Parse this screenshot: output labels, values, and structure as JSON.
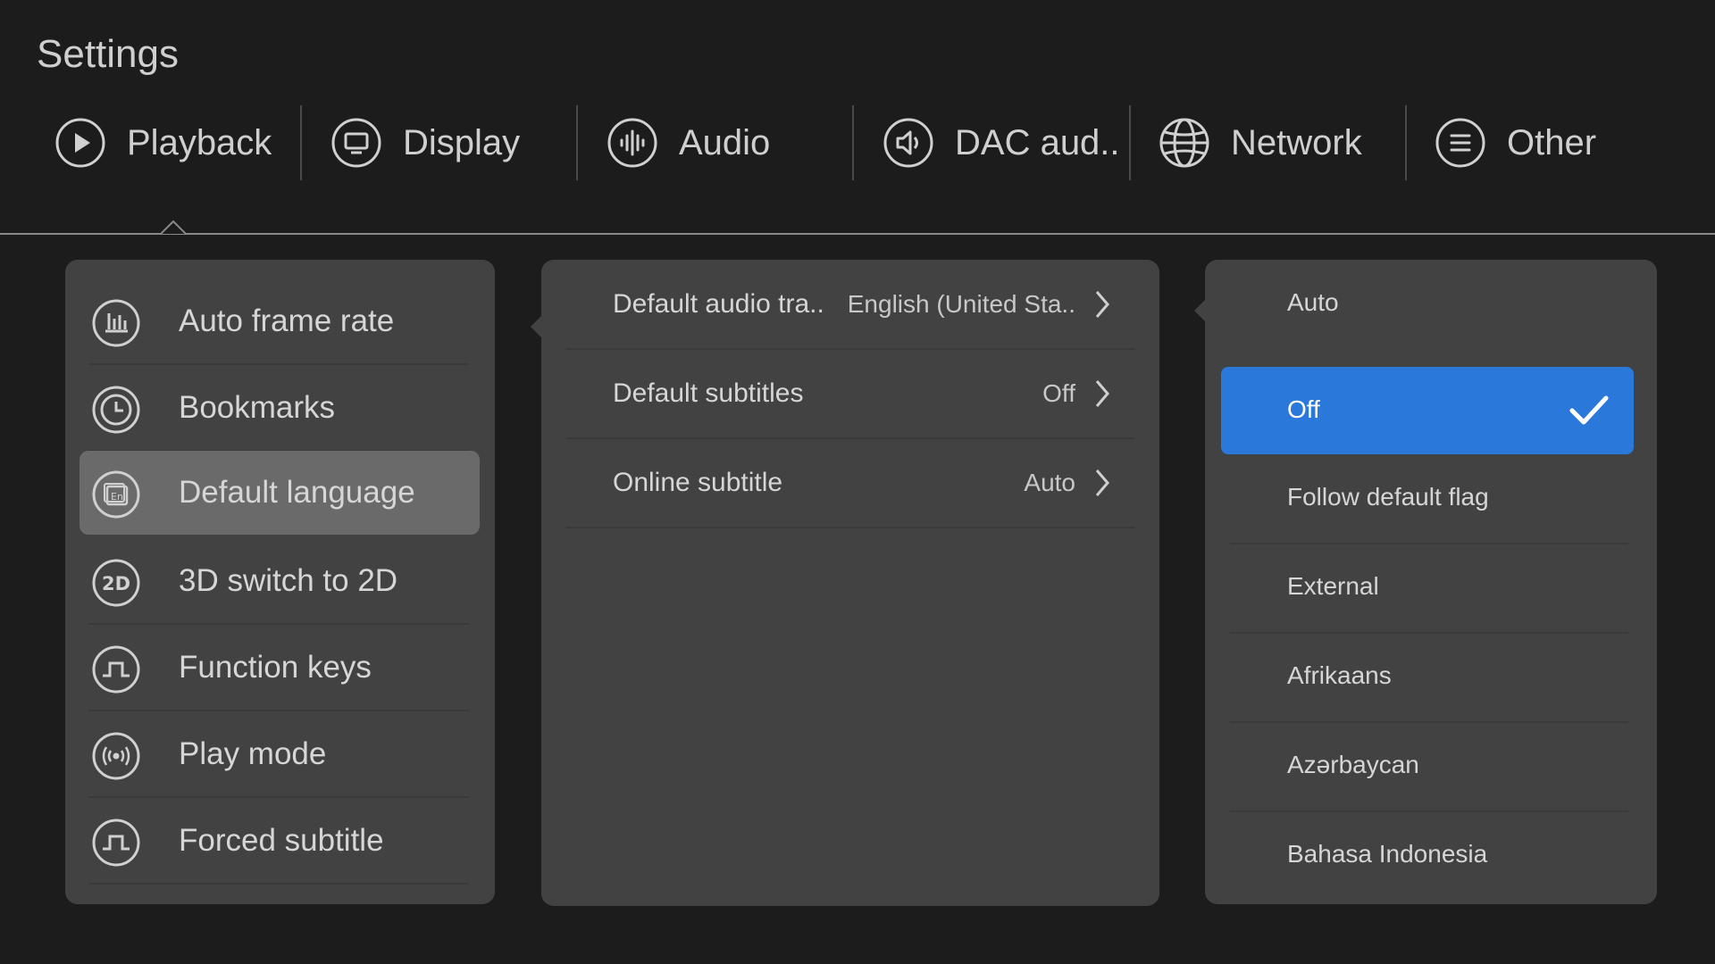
{
  "page": {
    "title": "Settings"
  },
  "tabs": [
    {
      "id": "playback",
      "label": "Playback",
      "icon": "play-icon"
    },
    {
      "id": "display",
      "label": "Display",
      "icon": "monitor-icon"
    },
    {
      "id": "audio",
      "label": "Audio",
      "icon": "audio-wave-icon"
    },
    {
      "id": "dac",
      "label": "DAC aud..",
      "icon": "speaker-icon"
    },
    {
      "id": "network",
      "label": "Network",
      "icon": "globe-icon"
    },
    {
      "id": "other",
      "label": "Other",
      "icon": "menu-icon"
    }
  ],
  "active_tab": "Playback",
  "left_menu": {
    "selected": "Default language",
    "items": [
      {
        "label": "Auto frame rate",
        "icon": "bar-chart-icon"
      },
      {
        "label": "Bookmarks",
        "icon": "clock-icon"
      },
      {
        "label": "Default language",
        "icon": "language-en-icon"
      },
      {
        "label": "3D switch to 2D",
        "icon": "2d-icon"
      },
      {
        "label": "Function keys",
        "icon": "pulse-icon"
      },
      {
        "label": "Play mode",
        "icon": "broadcast-icon"
      },
      {
        "label": "Forced subtitle",
        "icon": "pulse-icon"
      }
    ]
  },
  "middle_menu": {
    "items": [
      {
        "label": "Default audio tra..",
        "value": "English (United Sta.."
      },
      {
        "label": "Default subtitles",
        "value": "Off"
      },
      {
        "label": "Online subtitle",
        "value": "Auto"
      }
    ]
  },
  "options": {
    "selected": "Off",
    "items": [
      {
        "label": "Auto"
      },
      {
        "label": "Off"
      },
      {
        "label": "Follow default flag"
      },
      {
        "label": "External"
      },
      {
        "label": "Afrikaans"
      },
      {
        "label": "Azərbaycan"
      },
      {
        "label": "Bahasa Indonesia"
      }
    ]
  },
  "colors": {
    "background": "#1c1c1c",
    "panel": "#424242",
    "selected_item": "#6a6a6a",
    "accent": "#2a78d9"
  }
}
